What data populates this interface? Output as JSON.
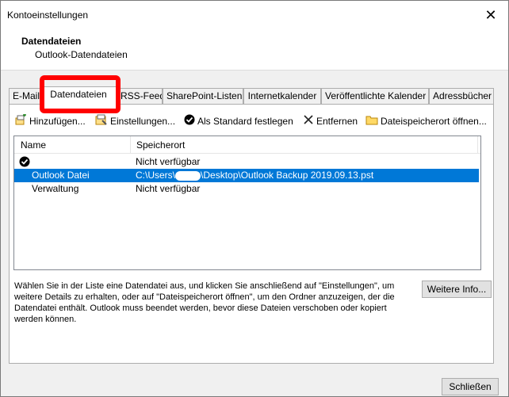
{
  "window": {
    "title": "Kontoeinstellungen",
    "close_glyph": "✕"
  },
  "header": {
    "title": "Datendateien",
    "subtitle": "Outlook-Datendateien"
  },
  "tabs": [
    {
      "label": "E-Mail"
    },
    {
      "label": "Datendateien"
    },
    {
      "label": "RSS-Feeds"
    },
    {
      "label": "SharePoint-Listen"
    },
    {
      "label": "Internetkalender"
    },
    {
      "label": "Veröffentlichte Kalender"
    },
    {
      "label": "Adressbücher"
    }
  ],
  "toolbar": {
    "add_label": "Hinzufügen...",
    "settings_label": "Einstellungen...",
    "default_label": "Als Standard festlegen",
    "remove_label": "Entfernen",
    "open_location_label": "Dateispeicherort öffnen..."
  },
  "list": {
    "col_name": "Name",
    "col_location": "Speicherort",
    "rows": [
      {
        "name": "",
        "location": "Nicht verfügbar",
        "default": true
      },
      {
        "name": "Outlook Datei",
        "location": "C:\\Users\\",
        "location_suffix": "\\Desktop\\Outlook Backup 2019.09.13.pst",
        "selected": true
      },
      {
        "name": "Verwaltung",
        "location": "Nicht verfügbar"
      }
    ]
  },
  "description": "Wählen Sie in der Liste eine Datendatei aus, und klicken Sie anschließend auf \"Einstellungen\", um weitere Details zu erhalten, oder auf \"Dateispeicherort öffnen\", um den Ordner anzuzeigen, der die Datendatei enthält. Outlook muss beendet werden, bevor diese Dateien verschoben oder kopiert werden können.",
  "buttons": {
    "more_info": "Weitere Info...",
    "close": "Schließen"
  },
  "colors": {
    "selection": "#0078d7",
    "highlight": "#ff0000"
  }
}
